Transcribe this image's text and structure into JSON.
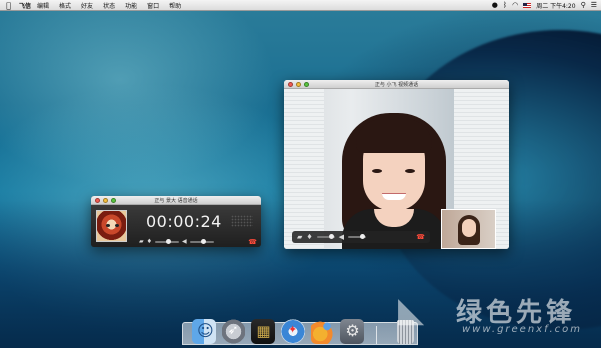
{
  "menubar": {
    "app_name": "飞信",
    "items": [
      "编辑",
      "格式",
      "好友",
      "状态",
      "功能",
      "窗口",
      "帮助"
    ],
    "clock": "周二 下午4:20",
    "status_icons": [
      "apple-icon",
      "qq-icon",
      "bluetooth-icon",
      "wifi-icon",
      "flag-icon",
      "search-icon",
      "list-icon"
    ]
  },
  "voice_call": {
    "title": "正与 景大 语音通话",
    "timer": "00:00:24"
  },
  "video_call": {
    "title": "正与 小飞 视频通话"
  },
  "dock": {
    "items": [
      "finder-icon",
      "launchpad-icon",
      "dashboard-icon",
      "safari-icon",
      "qq-icon",
      "system-preferences-icon",
      "trash-icon"
    ]
  },
  "watermark": {
    "brand": "绿色先锋",
    "url": "www.greenxf.com"
  }
}
